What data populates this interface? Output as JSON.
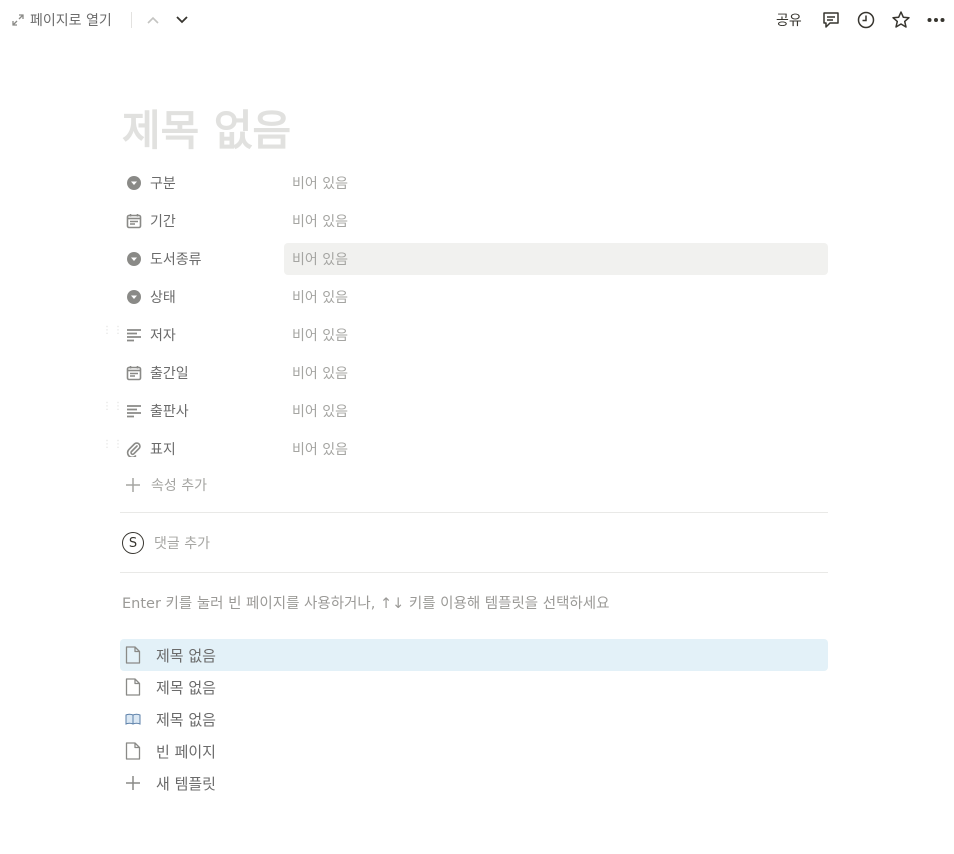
{
  "topbar": {
    "open_as_page": "페이지로 열기",
    "share": "공유"
  },
  "page": {
    "title": "제목 없음"
  },
  "properties": [
    {
      "name": "구분",
      "icon": "select-icon",
      "value": "비어 있음"
    },
    {
      "name": "기간",
      "icon": "calendar-icon",
      "value": "비어 있음"
    },
    {
      "name": "도서종류",
      "icon": "select-icon",
      "value": "비어 있음"
    },
    {
      "name": "상태",
      "icon": "select-icon",
      "value": "비어 있음"
    },
    {
      "name": "저자",
      "icon": "text-icon",
      "value": "비어 있음"
    },
    {
      "name": "출간일",
      "icon": "calendar-icon",
      "value": "비어 있음"
    },
    {
      "name": "출판사",
      "icon": "text-icon",
      "value": "비어 있음"
    },
    {
      "name": "표지",
      "icon": "paperclip-icon",
      "value": "비어 있음"
    }
  ],
  "add_property": "속성 추가",
  "comment": {
    "avatar_letter": "S",
    "placeholder": "댓글 추가"
  },
  "template_hint": "Enter 키를 눌러 빈 페이지를 사용하거나, ↑↓ 키를 이용해 템플릿을 선택하세요",
  "templates": [
    {
      "label": "제목 없음",
      "icon": "page-icon",
      "selected": true
    },
    {
      "label": "제목 없음",
      "icon": "page-icon",
      "selected": false
    },
    {
      "label": "제목 없음",
      "icon": "book-icon",
      "selected": false
    },
    {
      "label": "빈 페이지",
      "icon": "page-icon",
      "selected": false
    },
    {
      "label": "새 템플릿",
      "icon": "plus-icon",
      "selected": false
    }
  ],
  "colors": {
    "selected_template_bg": "#e3f1f8",
    "hover_value_bg": "#f1f1ef",
    "title_placeholder": "#e1e1df"
  }
}
